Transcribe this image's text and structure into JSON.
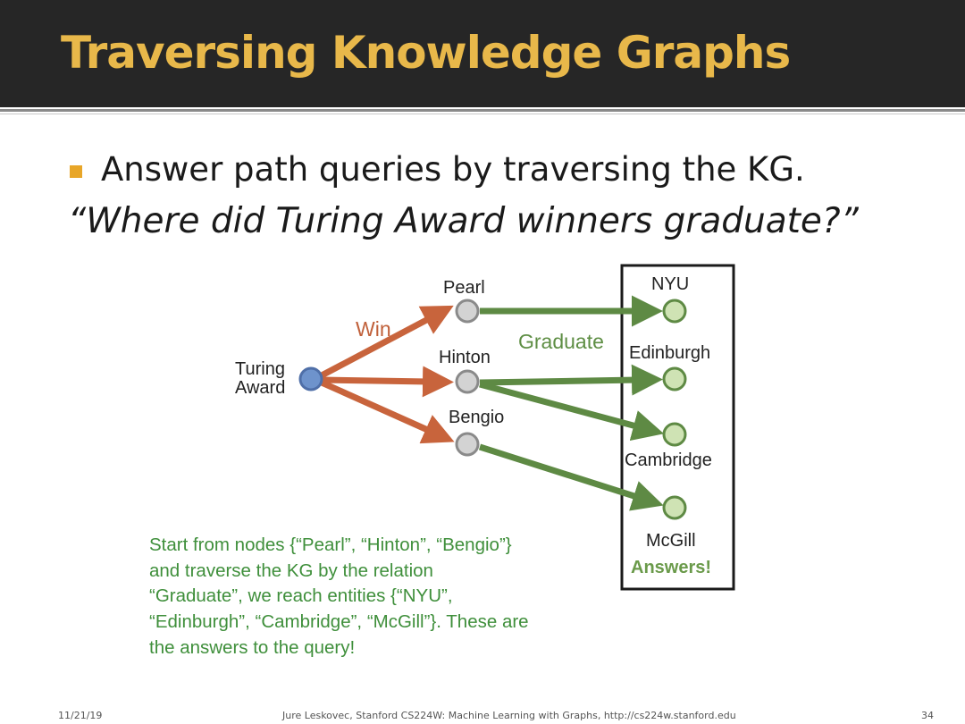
{
  "slide": {
    "title": "Traversing Knowledge Graphs",
    "bullet": "Answer path queries by traversing the KG.",
    "quote": "“Where did Turing Award winners graduate?”"
  },
  "diagram": {
    "source_line1": "Turing",
    "source_line2": "Award",
    "people": [
      "Pearl",
      "Hinton",
      "Bengio"
    ],
    "schools": [
      "NYU",
      "Edinburgh",
      "Cambridge",
      "McGill"
    ],
    "relation_win": "Win",
    "relation_graduate": "Graduate",
    "answers_label": "Answers!",
    "colors": {
      "win_edge": "#c8643c",
      "graduate_edge": "#5e8a44",
      "source_node": "#6e93cc",
      "person_node": "#d3d3d3",
      "school_node": "#cfe3b4"
    }
  },
  "description": [
    "Start from nodes {“Pearl”, “Hinton”, “Bengio”}",
    "and traverse the KG by the relation",
    "“Graduate”, we reach entities {“NYU”,",
    "“Edinburgh”, “Cambridge”, “McGill”}. These are",
    "the answers to the query!"
  ],
  "footer": {
    "date": "11/21/19",
    "credit": "Jure Leskovec, Stanford CS224W: Machine Learning with Graphs, http://cs224w.stanford.edu",
    "page": "34"
  }
}
